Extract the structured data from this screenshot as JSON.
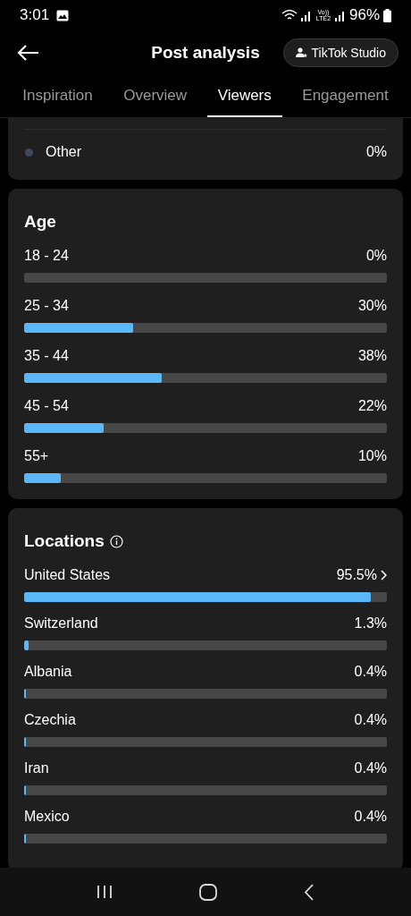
{
  "status_bar": {
    "time": "3:01",
    "battery": "96%",
    "network_label": "Vo)) LTE2"
  },
  "header": {
    "title": "Post analysis",
    "studio_button": "TikTok Studio"
  },
  "tabs": [
    {
      "label": "Inspiration",
      "selected": false
    },
    {
      "label": "Overview",
      "selected": false
    },
    {
      "label": "Viewers",
      "selected": true
    },
    {
      "label": "Engagement",
      "selected": false
    }
  ],
  "gender_partial": {
    "items": [
      {
        "label": "Other",
        "value": "0%",
        "color": "#3e4a5a"
      }
    ]
  },
  "age": {
    "title": "Age",
    "rows": [
      {
        "label": "18 - 24",
        "value": "0%",
        "level": 0
      },
      {
        "label": "25 - 34",
        "value": "30%",
        "level": 0.3
      },
      {
        "label": "35 - 44",
        "value": "38%",
        "level": 0.38
      },
      {
        "label": "45 - 54",
        "value": "22%",
        "level": 0.22
      },
      {
        "label": "55+",
        "value": "10%",
        "level": 0.1
      }
    ]
  },
  "locations": {
    "title": "Locations",
    "rows": [
      {
        "label": "United States",
        "value": "95.5%",
        "level": 0.955,
        "expandable": true
      },
      {
        "label": "Switzerland",
        "value": "1.3%",
        "level": 0.013,
        "expandable": false
      },
      {
        "label": "Albania",
        "value": "0.4%",
        "level": 0.004,
        "expandable": false
      },
      {
        "label": "Czechia",
        "value": "0.4%",
        "level": 0.004,
        "expandable": false
      },
      {
        "label": "Iran",
        "value": "0.4%",
        "level": 0.004,
        "expandable": false
      },
      {
        "label": "Mexico",
        "value": "0.4%",
        "level": 0.004,
        "expandable": false
      }
    ]
  }
}
